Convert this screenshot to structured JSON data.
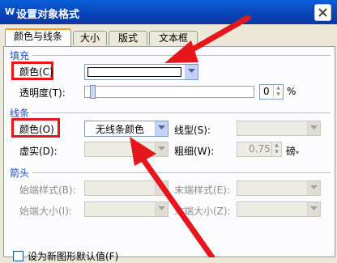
{
  "window": {
    "title": "设置对象格式",
    "logo": "W"
  },
  "tabs": [
    {
      "label": "颜色与线条",
      "active": true
    },
    {
      "label": "大小",
      "active": false
    },
    {
      "label": "版式",
      "active": false
    },
    {
      "label": "文本框",
      "active": false
    }
  ],
  "fill": {
    "section_label": "填充",
    "color_label": "颜色(C)",
    "color_value": "#ffffff",
    "transparency_label": "透明度(T):",
    "transparency_value": "0",
    "transparency_unit": "%"
  },
  "line": {
    "section_label": "线条",
    "color_label": "颜色(O)",
    "color_value": "无线条颜色",
    "style_label": "线型(S):",
    "dash_label": "虚实(D):",
    "weight_label": "粗细(W):",
    "weight_value": "0.75",
    "weight_unit": "磅"
  },
  "arrows": {
    "section_label": "箭头",
    "begin_style_label": "始端样式(B):",
    "end_style_label": "末端样式(E):",
    "begin_size_label": "始端大小(I):",
    "end_size_label": "末端大小(Z):"
  },
  "footer": {
    "default_checkbox_label": "设为新图形默认值(F)"
  },
  "colors": {
    "highlight": "#e5161c",
    "titlebar": "#0a5fd8",
    "section": "#1f4ed1"
  },
  "icons": [
    "word-logo-icon",
    "close-icon",
    "chevron-down-icon",
    "annotation-arrow-icon"
  ]
}
